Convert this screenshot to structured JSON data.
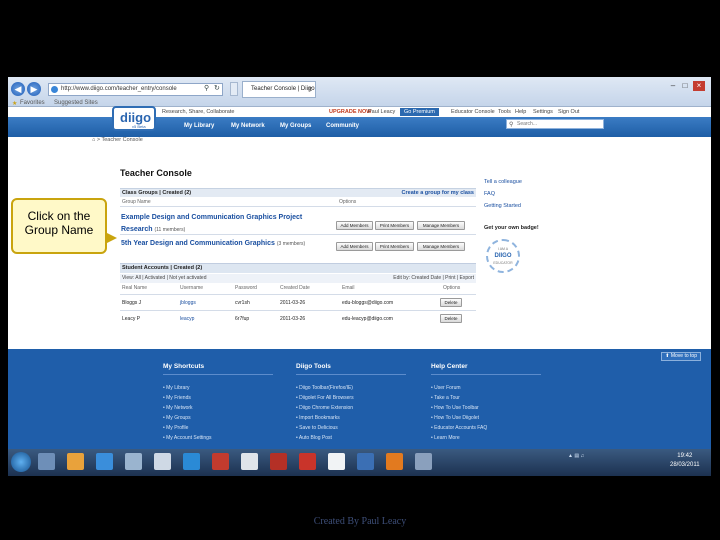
{
  "browser": {
    "url": "http://www.diigo.com/teacher_entry/console",
    "tab_title": "Teacher Console | Diigo",
    "tab_close": "x",
    "favorites_label": "Favorites",
    "suggested_sites": "Suggested Sites"
  },
  "header": {
    "tools": "Research, Share, Collaborate",
    "premium_ad": "UPGRADE NOW",
    "user": "Paul Leacy",
    "premium": "Go Premium",
    "educator": "Educator Console",
    "tools_link": "Tools",
    "help": "Help",
    "settings": "Settings",
    "sign_out": "Sign Out"
  },
  "logo": {
    "text": "diigo",
    "tagline": "v5 Beta"
  },
  "nav": {
    "items": [
      {
        "label": "My Library"
      },
      {
        "label": "My Network"
      },
      {
        "label": "My Groups"
      },
      {
        "label": "Community"
      }
    ],
    "search_placeholder": "Search..."
  },
  "breadcrumb": "> Teacher Console",
  "page_title": "Teacher Console",
  "groups": {
    "header": "Class Groups | Created (2)",
    "create_link": "Create a group for my class",
    "col_name": "Group Name",
    "col_options": "Options",
    "rows": [
      {
        "name": "Example Design and Communication Graphics Project Research",
        "members": "(11 members)",
        "add": "Add Members",
        "print": "Print Members",
        "manage": "Manage Members"
      },
      {
        "name": "5th Year Design and Communication Graphics",
        "members": "(3 members)",
        "add": "Add Members",
        "print": "Print Members",
        "manage": "Manage Members"
      }
    ]
  },
  "students": {
    "header": "Student Accounts | Created (2)",
    "filter": "View: All | Activated | Not yet activated",
    "filter_right": "Edit by: Created Date | Print | Export",
    "cols": [
      "Real Name",
      "Username",
      "Password",
      "Created Date",
      "Email",
      "Options"
    ],
    "rows": [
      {
        "name": "Bloggs J",
        "username": "jbloggs",
        "password": "cvr1sh",
        "date": "2011-03-26",
        "email": "edu-bloggs@diigo.com",
        "action": "Delete"
      },
      {
        "name": "Leacy P",
        "username": "leacyp",
        "password": "6r7fup",
        "date": "2011-03-26",
        "email": "edu-leacyp@diigo.com",
        "action": "Delete"
      }
    ]
  },
  "sidebar": {
    "links": [
      "Tell a colleague",
      "FAQ",
      "Getting Started"
    ],
    "badge_heading": "Get your own badge!",
    "badge_top": "I AM A",
    "badge_main": "DIIGO",
    "badge_bottom": "EDUCATOR"
  },
  "callout": {
    "line1": "Click on the",
    "line2": "Group Name"
  },
  "footer": {
    "move_top": "Move to top",
    "columns": [
      {
        "title": "My Shortcuts",
        "links": [
          "My Library",
          "My Friends",
          "My Network",
          "My Groups",
          "My Profile",
          "My Account Settings"
        ]
      },
      {
        "title": "Diigo Tools",
        "links": [
          "Diigo Toolbar(Firefox/IE)",
          "Diigolet For All Browsers",
          "Diigo Chrome Extension",
          "Import Bookmarks",
          "Save to Delicious",
          "Auto Blog Post"
        ]
      },
      {
        "title": "Help Center",
        "links": [
          "User Forum",
          "Take a Tour",
          "How To Use Toolbar",
          "How To Use Diigolet",
          "Educator Accounts FAQ",
          "Learn More"
        ]
      }
    ]
  },
  "taskbar": {
    "time": "19:42",
    "date": "28/03/2011",
    "app_colors": [
      "#6e8fb8",
      "#e9a23b",
      "#3a8edb",
      "#9ab4cf",
      "#cfd9e5",
      "#2a8ad6",
      "#c23b2e",
      "#dfe4ea",
      "#b43026",
      "#c9342a",
      "#f1f3f5",
      "#3b6fb4",
      "#e27a1f",
      "#8aa0bd"
    ]
  },
  "credit": "Created By Paul Leacy"
}
